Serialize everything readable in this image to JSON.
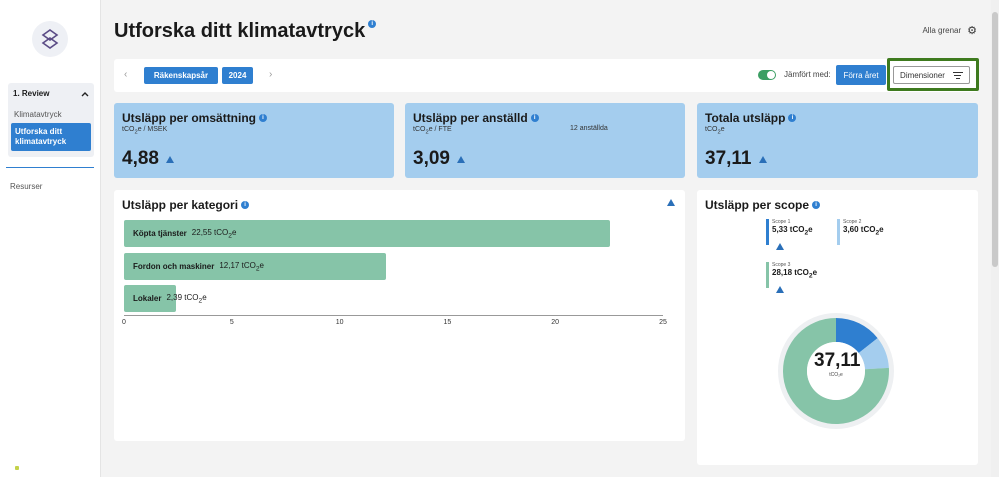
{
  "sidebar": {
    "group_label": "1. Review",
    "items": [
      "Klimatavtryck",
      "Utforska ditt klimatavtryck"
    ],
    "resources_label": "Resurser"
  },
  "header": {
    "title": "Utforska ditt klimatavtryck",
    "branches_label": "Alla grenar"
  },
  "toolbar": {
    "period_type": "Räkenskapsår",
    "year": "2024",
    "compare_label": "Jämfört med:",
    "compare_value": "Förra året",
    "dimensions_label": "Dimensioner"
  },
  "kpis": [
    {
      "title": "Utsläpp per omsättning",
      "unit_pre": "tCO",
      "unit_sub": "2",
      "unit_post": "e / MSEK",
      "extra": "",
      "value": "4,88"
    },
    {
      "title": "Utsläpp per anställd",
      "unit_pre": "tCO",
      "unit_sub": "2",
      "unit_post": "e / FTE",
      "extra": "12 anställda",
      "value": "3,09"
    },
    {
      "title": "Totala utsläpp",
      "unit_pre": "tCO",
      "unit_sub": "2",
      "unit_post": "e",
      "extra": "",
      "value": "37,11"
    }
  ],
  "category_card": {
    "title": "Utsläpp per kategori",
    "bars": [
      {
        "label": "Köpta tjänster",
        "value_text": "22,55 tCO",
        "value": 22.55
      },
      {
        "label": "Fordon och maskiner",
        "value_text": "12,17 tCO",
        "value": 12.17
      },
      {
        "label": "Lokaler",
        "value_text": "2,39 tCO",
        "value": 2.39
      }
    ],
    "unit_sub": "2",
    "unit_post": "e",
    "ticks": [
      "0",
      "5",
      "10",
      "15",
      "20",
      "25"
    ]
  },
  "scope_card": {
    "title": "Utsläpp per scope",
    "scopes": [
      {
        "label": "Scope 1",
        "value_pre": "5,33 tCO",
        "value": 5.33,
        "color": "#2f7fd0"
      },
      {
        "label": "Scope 2",
        "value_pre": "3,60 tCO",
        "value": 3.6,
        "color": "#a4cdee"
      },
      {
        "label": "Scope 3",
        "value_pre": "28,18 tCO",
        "value": 28.18,
        "color": "#86c4a8"
      }
    ],
    "unit_sub": "2",
    "unit_post": "e",
    "total": "37,11",
    "total_unit": "tCO₂e"
  },
  "chart_data": [
    {
      "type": "bar",
      "title": "Utsläpp per kategori",
      "categories": [
        "Köpta tjänster",
        "Fordon och maskiner",
        "Lokaler"
      ],
      "values": [
        22.55,
        12.17,
        2.39
      ],
      "xlim": [
        0,
        25
      ],
      "orientation": "horizontal"
    },
    {
      "type": "pie",
      "title": "Utsläpp per scope",
      "categories": [
        "Scope 1",
        "Scope 2",
        "Scope 3"
      ],
      "values": [
        5.33,
        3.6,
        28.18
      ]
    }
  ],
  "colors": {
    "accent": "#2f7fd0",
    "kpi_bg": "#a4cdee",
    "bar_green": "#86c4a8",
    "highlight_border": "#3e7a1e"
  }
}
